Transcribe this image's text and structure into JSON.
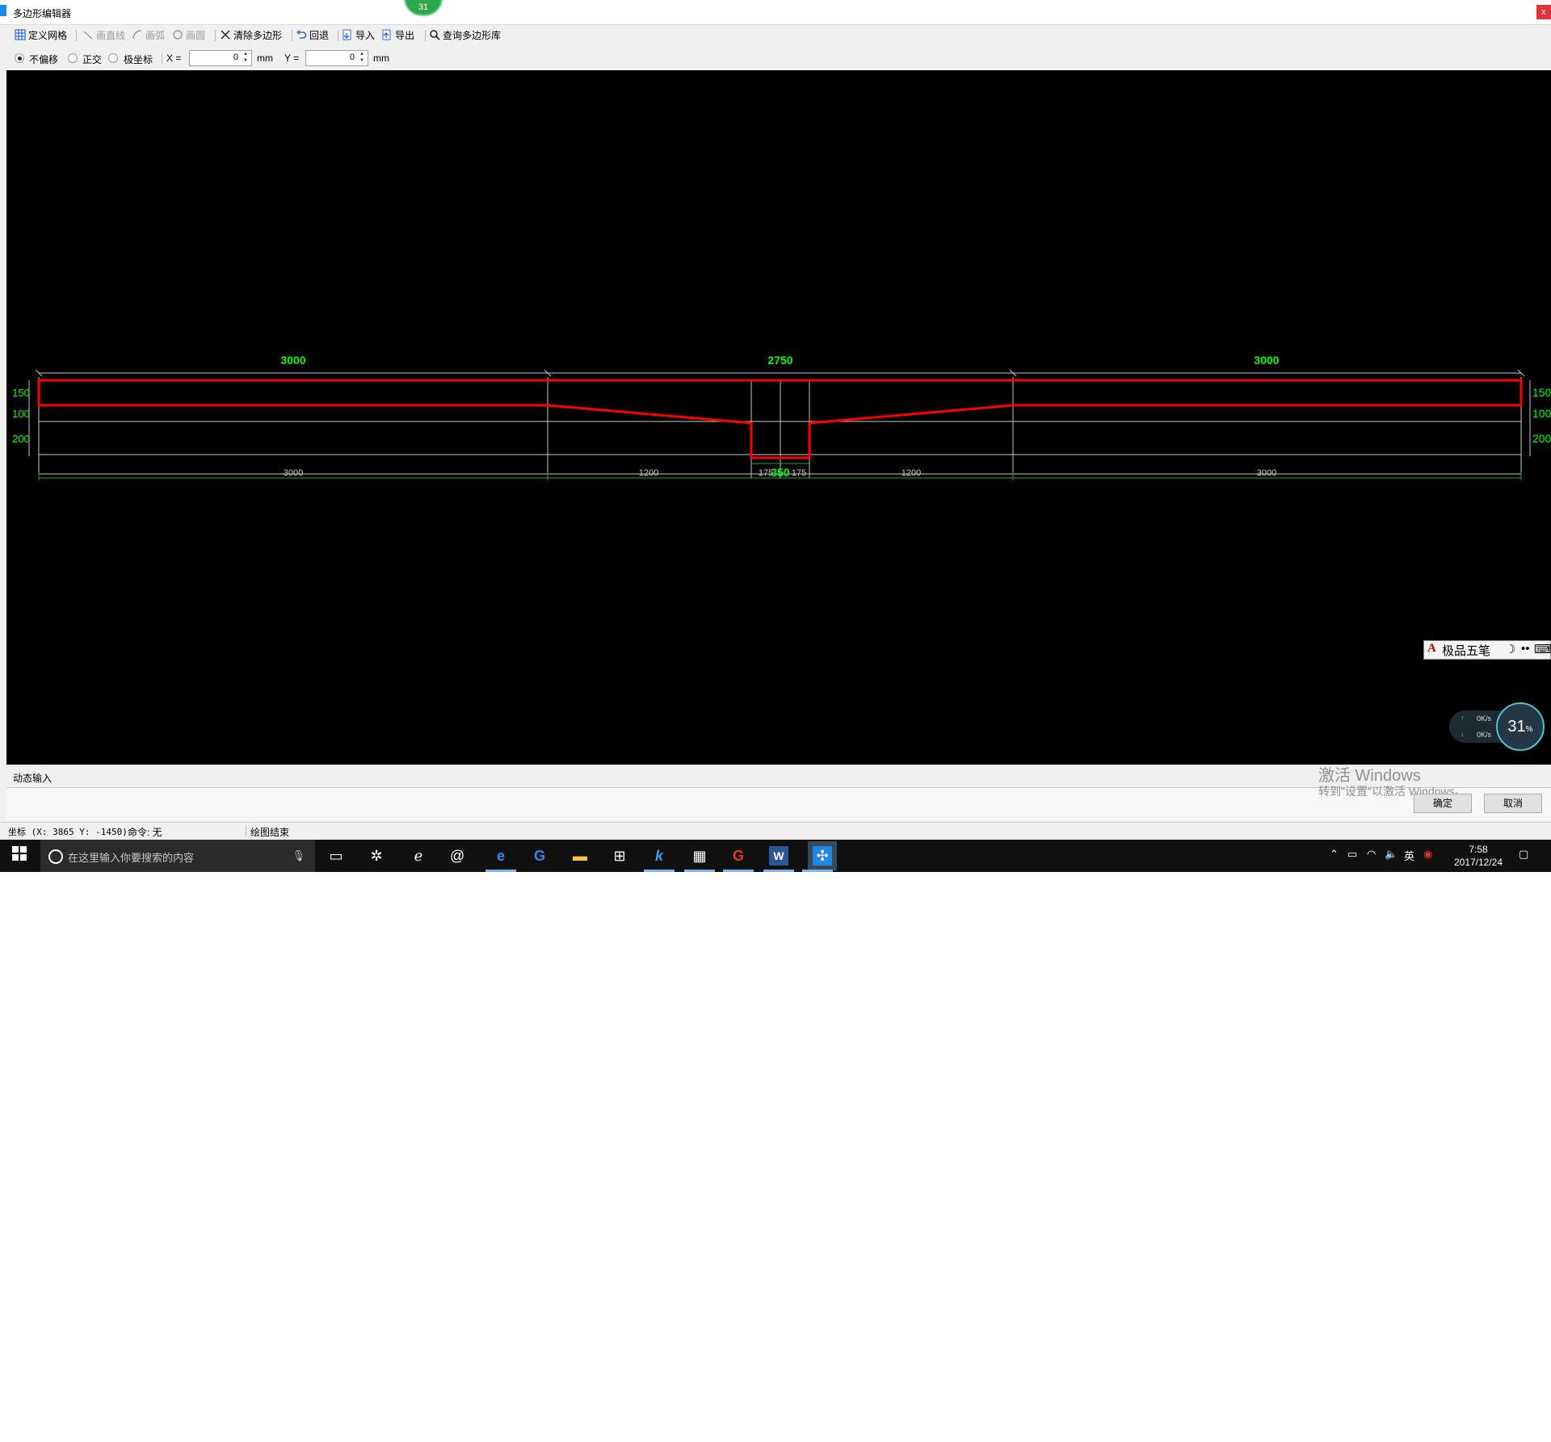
{
  "window": {
    "title": "多边形编辑器",
    "close_glyph": "x",
    "notify_badge": "31"
  },
  "toolbar": {
    "define_grid": "定义网格",
    "draw_line": "画直线",
    "draw_arc": "画弧",
    "draw_circle": "画圆",
    "clear_polygon": "清除多边形",
    "undo": "回退",
    "import": "导入",
    "export": "导出",
    "query_library": "查询多边形库"
  },
  "options": {
    "no_offset": "不偏移",
    "orthogonal": "正交",
    "polar": "极坐标",
    "selected": "no_offset",
    "x_label": "X =",
    "x_value": "0",
    "x_unit": "mm",
    "y_label": "Y =",
    "y_value": "0",
    "y_unit": "mm"
  },
  "drawing": {
    "top_dims": [
      "3000",
      "2750",
      "3000"
    ],
    "left_dims": [
      "150",
      "100",
      "200"
    ],
    "right_dims": [
      "150",
      "100",
      "200"
    ],
    "bottom_dims": [
      "3000",
      "1200",
      "175",
      "350",
      "175",
      "1200",
      "3000"
    ],
    "outline_color": "#ff0000",
    "dim_color": "#00ff00",
    "grid_color": "#c8c8c8"
  },
  "ime": {
    "label": "极品五笔"
  },
  "net_monitor": {
    "up": "0K/s",
    "down": "0K/s",
    "percent": "31",
    "percent_unit": "%"
  },
  "dynamic_input": {
    "label": "动态输入"
  },
  "watermark": {
    "line1": "激活 Windows",
    "line2": "转到\"设置\"以激活 Windows。"
  },
  "buttons": {
    "ok": "确定",
    "cancel": "取消"
  },
  "status": {
    "coords": "坐标 (X: 3865 Y: -1450)",
    "command": "命令: 无",
    "message": "绘图结束"
  },
  "taskbar": {
    "search_placeholder": "在这里输入你要搜索的内容",
    "time": "7:58",
    "date": "2017/12/24",
    "ime_indicator": "英"
  }
}
